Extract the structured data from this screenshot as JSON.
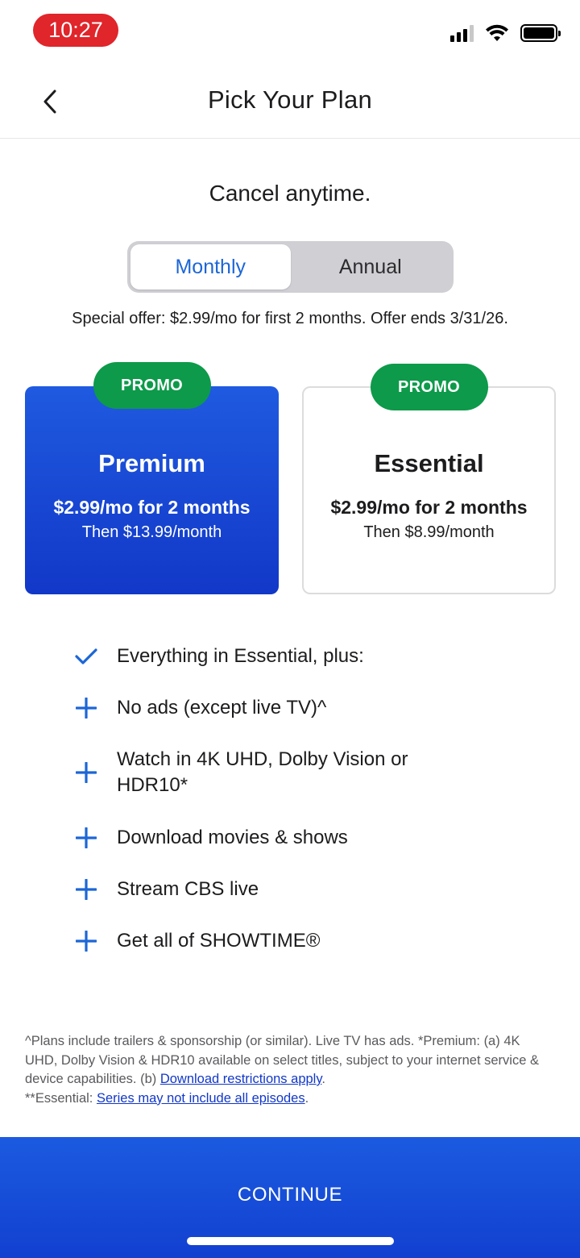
{
  "status_bar": {
    "time": "10:27"
  },
  "header": {
    "title": "Pick Your Plan"
  },
  "intro": {
    "cancel_text": "Cancel anytime."
  },
  "billing_toggle": {
    "options": [
      "Monthly",
      "Annual"
    ],
    "selected": "Monthly"
  },
  "offer_text": "Special offer: $2.99/mo for first 2 months. Offer ends 3/31/26.",
  "plans": [
    {
      "badge": "PROMO",
      "name": "Premium",
      "price": "$2.99/mo for 2 months",
      "then": "Then $13.99/month",
      "selected": true
    },
    {
      "badge": "PROMO",
      "name": "Essential",
      "price": "$2.99/mo for 2 months",
      "then": "Then $8.99/month",
      "selected": false
    }
  ],
  "features": [
    {
      "icon": "check-icon",
      "text": "Everything in Essential, plus:"
    },
    {
      "icon": "plus-icon",
      "text": "No ads (except live TV)^"
    },
    {
      "icon": "plus-icon",
      "text": "Watch in 4K UHD, Dolby Vision or HDR10*"
    },
    {
      "icon": "plus-icon",
      "text": "Download movies & shows"
    },
    {
      "icon": "plus-icon",
      "text": "Stream CBS live"
    },
    {
      "icon": "plus-icon",
      "text": "Get all of SHOWTIME®"
    }
  ],
  "footnote": {
    "part1": "^Plans include trailers & sponsorship (or similar). Live TV has ads. *Premium: (a) 4K UHD, Dolby Vision & HDR10 available on select titles, subject to your internet service & device capabilities. (b) ",
    "link1": "Download restrictions apply",
    "part2": ".",
    "part3": "**Essential: ",
    "link2": "Series may not include all episodes",
    "part4": "."
  },
  "cta": {
    "label": "CONTINUE"
  },
  "colors": {
    "accent_blue": "#1c66d6",
    "promo_green": "#0d9a4a",
    "card_blue": "#1238c8"
  }
}
